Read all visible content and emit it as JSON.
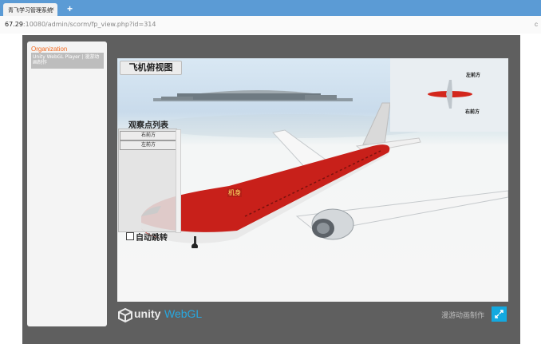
{
  "browser": {
    "tab_title": "青飞学习管理系统",
    "tab_close": "×",
    "new_tab": "+",
    "url_host": "67.29",
    "url_path": ":10080/admin/scorm/fp_view.php?id=314",
    "addr_right": "c"
  },
  "sidebar": {
    "title": "Organization",
    "items": [
      {
        "label": "Unity WebGL Player | 漫游动画制作"
      }
    ]
  },
  "scene": {
    "title": "飞机俯视图",
    "minimap": {
      "top_label": "左前方",
      "bottom_label": "右前方"
    },
    "observation": {
      "title": "观察点列表",
      "buttons": [
        "右前方",
        "左前方"
      ],
      "auto_turn_label": "自动跳转",
      "auto_turn_checked": false
    },
    "fuselage_tag": "机身"
  },
  "footer": {
    "unity": "unity",
    "webgl": "WebGL",
    "right_text": "漫游动画制作"
  },
  "colors": {
    "tabbar": "#5b9bd5",
    "accent": "#13a9e0",
    "org_title": "#f36b21",
    "plane_red": "#c8201a"
  }
}
